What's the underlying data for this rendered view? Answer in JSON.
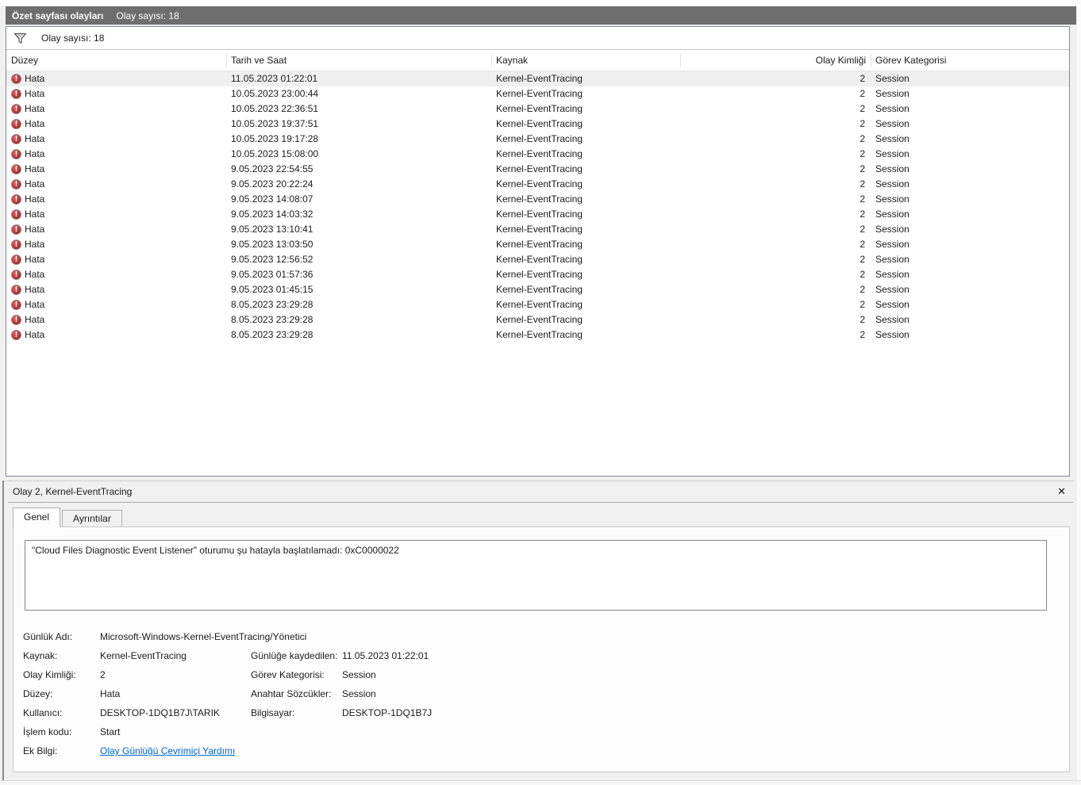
{
  "icons": {
    "filter_icon": "funnel",
    "error_icon": "exclamation-circle",
    "close_glyph": "✕"
  },
  "header": {
    "title": "Özet sayfası olayları",
    "count_label": "Olay sayısı: 18"
  },
  "filter": {
    "label": "Olay sayısı: 18"
  },
  "table": {
    "columns": [
      "Düzey",
      "Tarih ve Saat",
      "Kaynak",
      "Olay Kimliği",
      "Görev Kategorisi"
    ],
    "selected_index": 0,
    "rows": [
      {
        "level": "Hata",
        "datetime": "11.05.2023 01:22:01",
        "source": "Kernel-EventTracing",
        "event_id": "2",
        "category": "Session"
      },
      {
        "level": "Hata",
        "datetime": "10.05.2023 23:00:44",
        "source": "Kernel-EventTracing",
        "event_id": "2",
        "category": "Session"
      },
      {
        "level": "Hata",
        "datetime": "10.05.2023 22:36:51",
        "source": "Kernel-EventTracing",
        "event_id": "2",
        "category": "Session"
      },
      {
        "level": "Hata",
        "datetime": "10.05.2023 19:37:51",
        "source": "Kernel-EventTracing",
        "event_id": "2",
        "category": "Session"
      },
      {
        "level": "Hata",
        "datetime": "10.05.2023 19:17:28",
        "source": "Kernel-EventTracing",
        "event_id": "2",
        "category": "Session"
      },
      {
        "level": "Hata",
        "datetime": "10.05.2023 15:08:00",
        "source": "Kernel-EventTracing",
        "event_id": "2",
        "category": "Session"
      },
      {
        "level": "Hata",
        "datetime": "9.05.2023 22:54:55",
        "source": "Kernel-EventTracing",
        "event_id": "2",
        "category": "Session"
      },
      {
        "level": "Hata",
        "datetime": "9.05.2023 20:22:24",
        "source": "Kernel-EventTracing",
        "event_id": "2",
        "category": "Session"
      },
      {
        "level": "Hata",
        "datetime": "9.05.2023 14:08:07",
        "source": "Kernel-EventTracing",
        "event_id": "2",
        "category": "Session"
      },
      {
        "level": "Hata",
        "datetime": "9.05.2023 14:03:32",
        "source": "Kernel-EventTracing",
        "event_id": "2",
        "category": "Session"
      },
      {
        "level": "Hata",
        "datetime": "9.05.2023 13:10:41",
        "source": "Kernel-EventTracing",
        "event_id": "2",
        "category": "Session"
      },
      {
        "level": "Hata",
        "datetime": "9.05.2023 13:03:50",
        "source": "Kernel-EventTracing",
        "event_id": "2",
        "category": "Session"
      },
      {
        "level": "Hata",
        "datetime": "9.05.2023 12:56:52",
        "source": "Kernel-EventTracing",
        "event_id": "2",
        "category": "Session"
      },
      {
        "level": "Hata",
        "datetime": "9.05.2023 01:57:36",
        "source": "Kernel-EventTracing",
        "event_id": "2",
        "category": "Session"
      },
      {
        "level": "Hata",
        "datetime": "9.05.2023 01:45:15",
        "source": "Kernel-EventTracing",
        "event_id": "2",
        "category": "Session"
      },
      {
        "level": "Hata",
        "datetime": "8.05.2023 23:29:28",
        "source": "Kernel-EventTracing",
        "event_id": "2",
        "category": "Session"
      },
      {
        "level": "Hata",
        "datetime": "8.05.2023 23:29:28",
        "source": "Kernel-EventTracing",
        "event_id": "2",
        "category": "Session"
      },
      {
        "level": "Hata",
        "datetime": "8.05.2023 23:29:28",
        "source": "Kernel-EventTracing",
        "event_id": "2",
        "category": "Session"
      }
    ]
  },
  "detail": {
    "title": "Olay 2, Kernel-EventTracing",
    "tabs": [
      {
        "label": "Genel",
        "active": true
      },
      {
        "label": "Ayrıntılar",
        "active": false
      }
    ],
    "description": "\"Cloud Files Diagnostic Event Listener\" oturumu şu hatayla başlatılamadı: 0xC0000022",
    "fields": [
      {
        "l1": "Günlük Adı:",
        "v1": "Microsoft-Windows-Kernel-EventTracing/Yönetici",
        "l2": "",
        "v2": "",
        "link": false
      },
      {
        "l1": "Kaynak:",
        "v1": "Kernel-EventTracing",
        "l2": "Günlüğe kaydedilen:",
        "v2": "11.05.2023 01:22:01",
        "link": false
      },
      {
        "l1": "Olay Kimliği:",
        "v1": "2",
        "l2": "Görev Kategorisi:",
        "v2": "Session",
        "link": false
      },
      {
        "l1": "Düzey:",
        "v1": "Hata",
        "l2": "Anahtar Sözcükler:",
        "v2": "Session",
        "link": false
      },
      {
        "l1": "Kullanıcı:",
        "v1": "DESKTOP-1DQ1B7J\\TARIK",
        "l2": "Bilgisayar:",
        "v2": "DESKTOP-1DQ1B7J",
        "link": false
      },
      {
        "l1": "İşlem kodu:",
        "v1": "Start",
        "l2": "",
        "v2": "",
        "link": false
      },
      {
        "l1": "Ek Bilgi:",
        "v1": "Olay Günlüğü Çevrimiçi Yardımı",
        "l2": "",
        "v2": "",
        "link": true
      }
    ]
  }
}
